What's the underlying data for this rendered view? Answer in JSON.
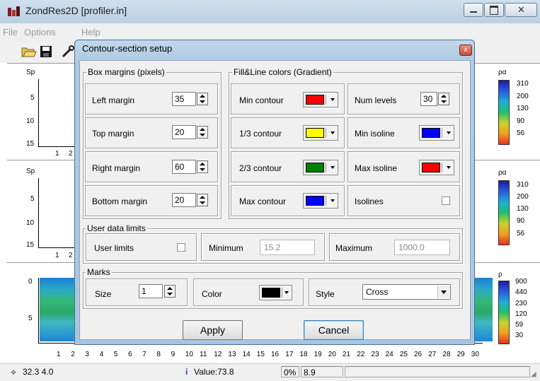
{
  "app": {
    "title": "ZondRes2D [profiler.in]",
    "menu": [
      "File",
      "Options",
      "Help"
    ]
  },
  "plots": {
    "panel1": {
      "axis_label": "Sp",
      "y_ticks": [
        "5",
        "10",
        "15"
      ],
      "x_ticks": [
        "1",
        "2"
      ],
      "scale_title": "ρα",
      "scale_values": [
        "310",
        "200",
        "130",
        "90",
        "56"
      ]
    },
    "panel2": {
      "axis_label": "Sp",
      "y_ticks": [
        "5",
        "10",
        "15"
      ],
      "x_ticks": [
        "1",
        "2"
      ],
      "scale_title": "ρα",
      "scale_values": [
        "310",
        "200",
        "130",
        "90",
        "56"
      ]
    },
    "panel3": {
      "y_ticks": [
        "0",
        "5"
      ],
      "x_ticks": [
        "1",
        "2",
        "3",
        "4",
        "5",
        "6",
        "7",
        "8",
        "9",
        "10",
        "11",
        "12",
        "13",
        "14",
        "15",
        "16",
        "17",
        "18",
        "19",
        "20",
        "21",
        "22",
        "23",
        "24",
        "25",
        "26",
        "27",
        "28",
        "29",
        "30"
      ],
      "scale_title": "ρ",
      "scale_values": [
        "900",
        "440",
        "230",
        "120",
        "59",
        "30"
      ]
    }
  },
  "status": {
    "coords": "32.3 4.0",
    "value": "Value:73.8",
    "percent": "0%",
    "extra": "8.9"
  },
  "dialog": {
    "title": "Contour-section setup",
    "close_glyph": "x",
    "box_margins": {
      "label": "Box margins (pixels)",
      "left": {
        "label": "Left margin",
        "value": "35"
      },
      "top": {
        "label": "Top margin",
        "value": "20"
      },
      "right": {
        "label": "Right margin",
        "value": "60"
      },
      "bottom": {
        "label": "Bottom margin",
        "value": "20"
      }
    },
    "fill_line": {
      "label": "Fill&Line colors (Gradient)",
      "min_contour": {
        "label": "Min contour",
        "color": "#ff0000"
      },
      "c13": {
        "label": "1/3 contour",
        "color": "#ffff00"
      },
      "c23": {
        "label": "2/3 contour",
        "color": "#008000"
      },
      "max_contour": {
        "label": "Max contour",
        "color": "#0000ff"
      },
      "num_levels": {
        "label": "Num levels",
        "value": "30"
      },
      "min_isoline": {
        "label": "Min isoline",
        "color": "#0000ff"
      },
      "max_isoline": {
        "label": "Max isoline",
        "color": "#ff0000"
      },
      "isolines": {
        "label": "Isolines",
        "checked": false
      }
    },
    "user_limits": {
      "label": "User data limits",
      "user_limits": {
        "label": "User limits",
        "checked": false
      },
      "minimum": {
        "label": "Minimum",
        "value": "15.2"
      },
      "maximum": {
        "label": "Maximum",
        "value": "1000.0"
      }
    },
    "marks": {
      "label": "Marks",
      "size": {
        "label": "Size",
        "value": "1"
      },
      "color": {
        "label": "Color",
        "color": "#000000"
      },
      "style": {
        "label": "Style",
        "value": "Cross"
      }
    },
    "apply_label": "Apply",
    "cancel_label": "Cancel"
  }
}
